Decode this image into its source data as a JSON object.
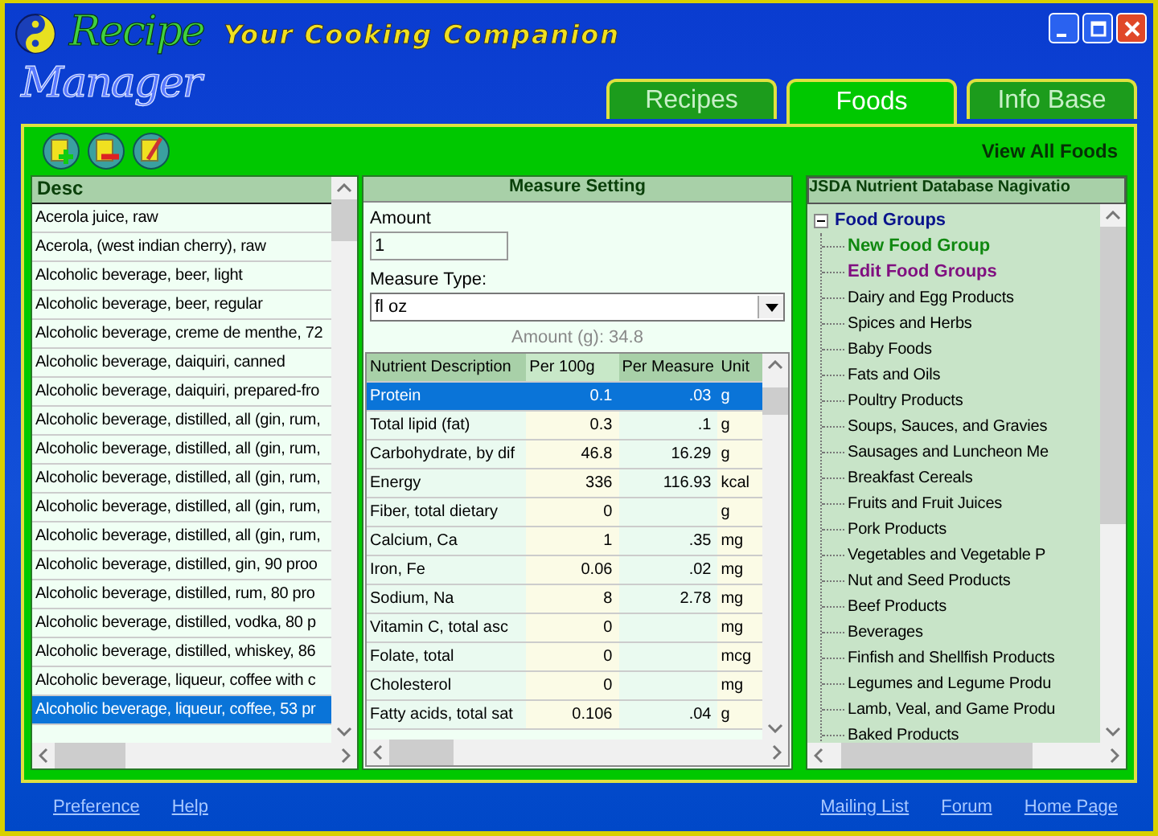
{
  "app": {
    "logo_top": "Recipe",
    "logo_bottom": "Manager",
    "tagline": "Your Cooking Companion"
  },
  "tabs": [
    {
      "label": "Recipes",
      "selected": false
    },
    {
      "label": "Foods",
      "selected": true
    },
    {
      "label": "Info Base",
      "selected": false
    }
  ],
  "toolbar": {
    "view_link": "View All Foods"
  },
  "food_list": {
    "column": "Desc",
    "rows": [
      {
        "text": "Acerola juice, raw",
        "selected": false
      },
      {
        "text": "Acerola, (west indian cherry), raw",
        "selected": false
      },
      {
        "text": "Alcoholic beverage, beer, light",
        "selected": false
      },
      {
        "text": "Alcoholic beverage, beer, regular",
        "selected": false
      },
      {
        "text": "Alcoholic beverage, creme de menthe, 72",
        "selected": false
      },
      {
        "text": "Alcoholic beverage, daiquiri, canned",
        "selected": false
      },
      {
        "text": "Alcoholic beverage, daiquiri, prepared-fro",
        "selected": false
      },
      {
        "text": "Alcoholic beverage, distilled, all (gin, rum,",
        "selected": false
      },
      {
        "text": "Alcoholic beverage, distilled, all (gin, rum,",
        "selected": false
      },
      {
        "text": "Alcoholic beverage, distilled, all (gin, rum,",
        "selected": false
      },
      {
        "text": "Alcoholic beverage, distilled, all (gin, rum,",
        "selected": false
      },
      {
        "text": "Alcoholic beverage, distilled, all (gin, rum,",
        "selected": false
      },
      {
        "text": "Alcoholic beverage, distilled, gin, 90 proo",
        "selected": false
      },
      {
        "text": "Alcoholic beverage, distilled, rum, 80 pro",
        "selected": false
      },
      {
        "text": "Alcoholic beverage, distilled, vodka, 80 p",
        "selected": false
      },
      {
        "text": "Alcoholic beverage, distilled, whiskey, 86",
        "selected": false
      },
      {
        "text": "Alcoholic beverage, liqueur, coffee with c",
        "selected": false
      },
      {
        "text": "Alcoholic beverage, liqueur, coffee, 53 pr",
        "selected": true
      }
    ]
  },
  "measure": {
    "title": "Measure Setting",
    "amount_label": "Amount",
    "amount_value": "1",
    "type_label": "Measure Type:",
    "type_value": "fl oz",
    "grams": "Amount (g): 34.8"
  },
  "nutrients": {
    "columns": [
      "Nutrient Description",
      "Per 100g",
      "Per Measure",
      "Unit"
    ],
    "rows": [
      {
        "name": "Protein",
        "per_100g": "0.1",
        "per_measure": ".03",
        "unit": "g",
        "selected": true
      },
      {
        "name": "Total lipid (fat)",
        "per_100g": "0.3",
        "per_measure": ".1",
        "unit": "g",
        "selected": false
      },
      {
        "name": "Carbohydrate, by dif",
        "per_100g": "46.8",
        "per_measure": "16.29",
        "unit": "g",
        "selected": false
      },
      {
        "name": "Energy",
        "per_100g": "336",
        "per_measure": "116.93",
        "unit": "kcal",
        "selected": false
      },
      {
        "name": "Fiber, total dietary",
        "per_100g": "0",
        "unit": "g",
        "selected": false
      },
      {
        "name": "Calcium, Ca",
        "per_100g": "1",
        "per_measure": ".35",
        "unit": "mg",
        "selected": false
      },
      {
        "name": "Iron, Fe",
        "per_100g": "0.06",
        "per_measure": ".02",
        "unit": "mg",
        "selected": false
      },
      {
        "name": "Sodium, Na",
        "per_100g": "8",
        "per_measure": "2.78",
        "unit": "mg",
        "selected": false
      },
      {
        "name": "Vitamin C, total asc",
        "per_100g": "0",
        "unit": "mg",
        "selected": false
      },
      {
        "name": "Folate, total",
        "per_100g": "0",
        "unit": "mcg",
        "selected": false
      },
      {
        "name": "Cholesterol",
        "per_100g": "0",
        "unit": "mg",
        "selected": false
      },
      {
        "name": "Fatty acids, total sat",
        "per_100g": "0.106",
        "per_measure": ".04",
        "unit": "g",
        "selected": false
      }
    ]
  },
  "navigator": {
    "title": "JSDA Nutrient Database Nagivatio",
    "root": {
      "label": "Food Groups",
      "expanded": true,
      "children": [
        {
          "label": "New Food Group",
          "kind": "new"
        },
        {
          "label": "Edit Food Groups",
          "kind": "edit"
        },
        {
          "label": "Dairy and Egg Products",
          "kind": "group"
        },
        {
          "label": "Spices and Herbs",
          "kind": "group"
        },
        {
          "label": "Baby Foods",
          "kind": "group"
        },
        {
          "label": "Fats and Oils",
          "kind": "group"
        },
        {
          "label": "Poultry Products",
          "kind": "group"
        },
        {
          "label": "Soups, Sauces, and Gravies",
          "kind": "group"
        },
        {
          "label": "Sausages and Luncheon Me",
          "kind": "group"
        },
        {
          "label": "Breakfast Cereals",
          "kind": "group"
        },
        {
          "label": "Fruits and Fruit Juices",
          "kind": "group"
        },
        {
          "label": "Pork Products",
          "kind": "group"
        },
        {
          "label": "Vegetables and Vegetable P",
          "kind": "group"
        },
        {
          "label": "Nut and Seed Products",
          "kind": "group"
        },
        {
          "label": "Beef Products",
          "kind": "group"
        },
        {
          "label": "Beverages",
          "kind": "group"
        },
        {
          "label": "Finfish and Shellfish Products",
          "kind": "group"
        },
        {
          "label": "Legumes and Legume Produ",
          "kind": "group"
        },
        {
          "label": "Lamb, Veal, and Game Produ",
          "kind": "group"
        },
        {
          "label": "Baked Products",
          "kind": "group"
        }
      ]
    }
  },
  "footer": {
    "left_links": [
      "Preference",
      "Help"
    ],
    "right_links": [
      "Mailing List",
      "Forum",
      "Home Page"
    ]
  }
}
